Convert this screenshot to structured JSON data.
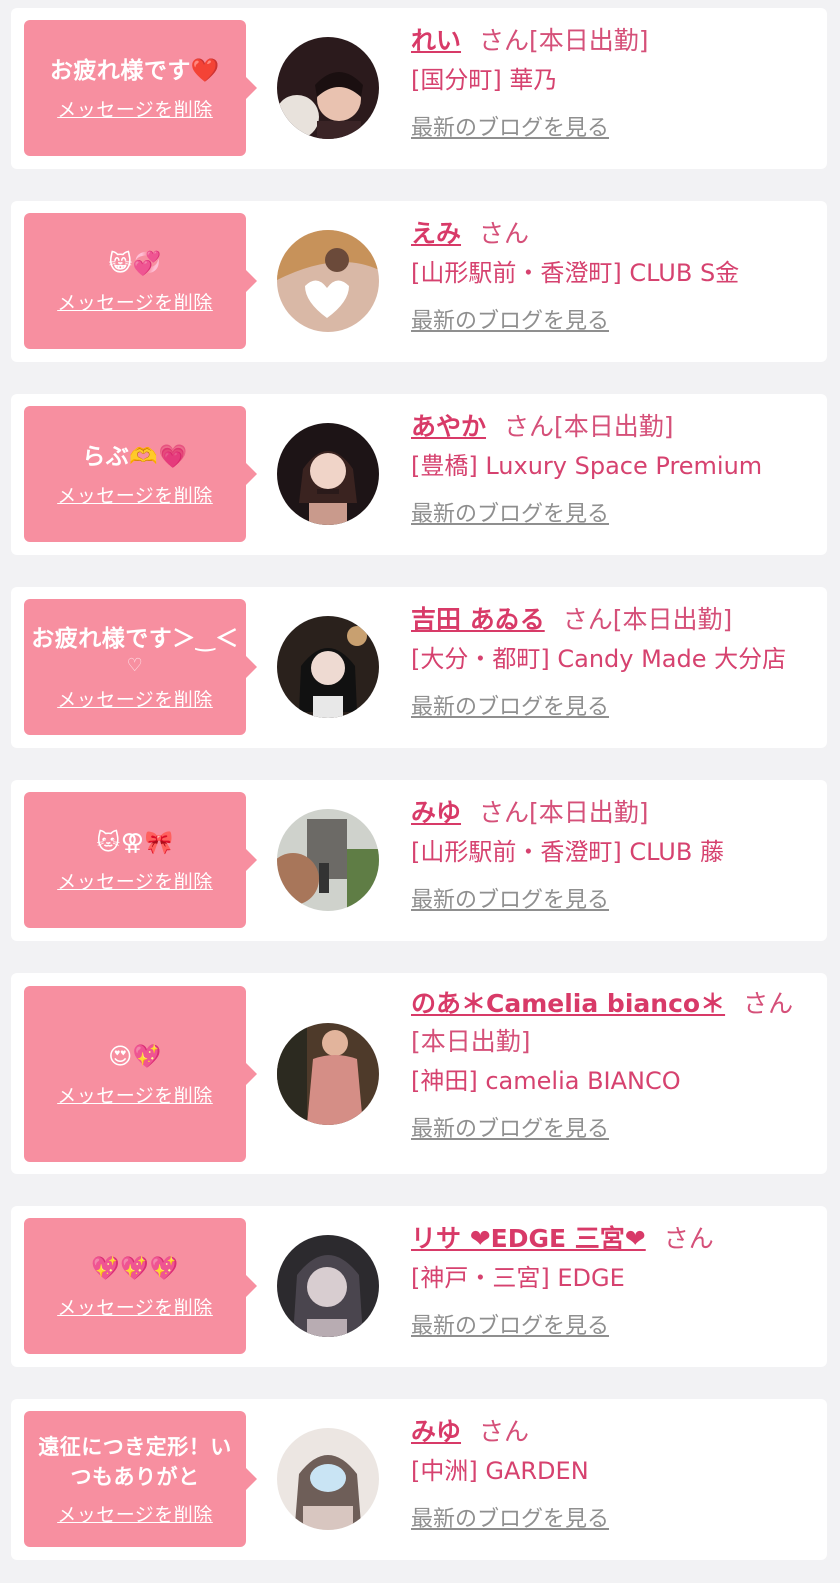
{
  "items": [
    {
      "message": "お疲れ様です❤️",
      "delete_label": "メッセージを削除",
      "name": "れい",
      "san": "さん",
      "status": "[本日出勤]",
      "shop": "[国分町] 華乃",
      "blog": "最新のブログを見る"
    },
    {
      "message": "😸💞",
      "delete_label": "メッセージを削除",
      "name": "えみ",
      "san": "さん",
      "status": "",
      "shop": "[山形駅前・香澄町] CLUB S金",
      "blog": "最新のブログを見る"
    },
    {
      "message": "らぶ🫶💗",
      "delete_label": "メッセージを削除",
      "name": "あやか",
      "san": "さん",
      "status": "[本日出勤]",
      "shop": "[豊橋] Luxury Space Premium",
      "blog": "最新のブログを見る"
    },
    {
      "message": "お疲れ様です＞‿＜",
      "message_sub": "♡",
      "delete_label": "メッセージを削除",
      "name": "吉田 あゐる",
      "san": "さん",
      "status": "[本日出勤]",
      "shop": "[大分・都町] Candy Made 大分店",
      "blog": "最新のブログを見る"
    },
    {
      "message": "🐱⚢🎀",
      "delete_label": "メッセージを削除",
      "name": "みゆ",
      "san": "さん",
      "status": "[本日出勤]",
      "shop": "[山形駅前・香澄町] CLUB 藤",
      "blog": "最新のブログを見る"
    },
    {
      "message": "😍💖",
      "delete_label": "メッセージを削除",
      "name": "のあ＊Camelia bianco＊",
      "san": "さん",
      "status": "[本日出勤]",
      "shop": "[神田] camelia BIANCO",
      "blog": "最新のブログを見る"
    },
    {
      "message": "💖💖💖",
      "delete_label": "メッセージを削除",
      "name": "リサ ❤EDGE 三宮❤",
      "san": "さん",
      "status": "",
      "shop": "[神戸・三宮] EDGE",
      "blog": "最新のブログを見る"
    },
    {
      "message": "遠征につき定形！いつもありがと",
      "delete_label": "メッセージを削除",
      "name": "みゆ",
      "san": "さん",
      "status": "",
      "shop": "[中洲] GARDEN",
      "blog": "最新のブログを見る"
    }
  ]
}
